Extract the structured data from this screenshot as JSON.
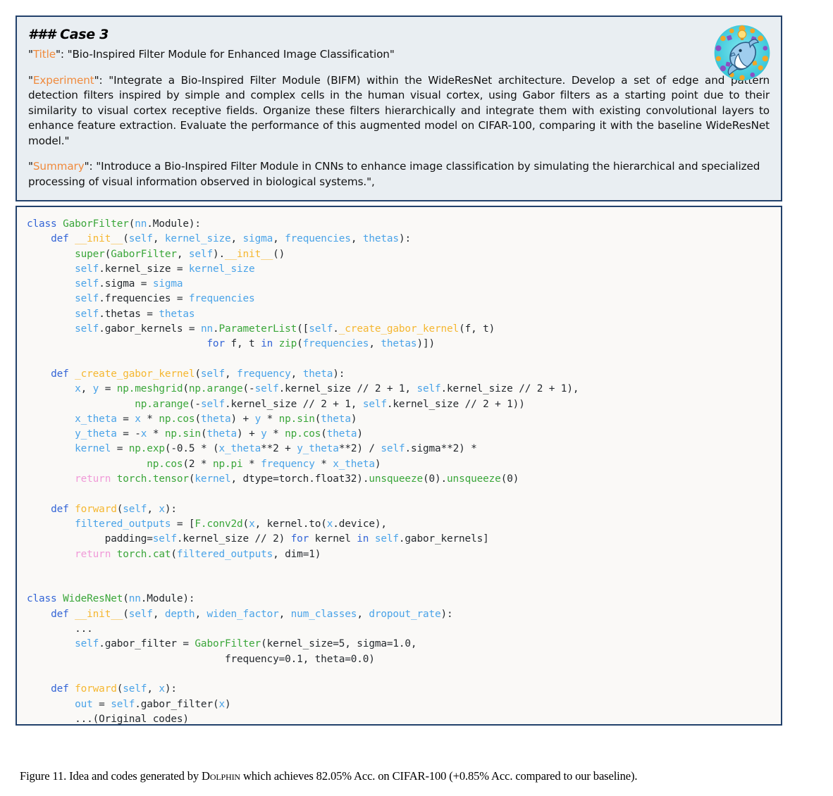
{
  "idea": {
    "case_heading_hashes": "###",
    "case_heading_text": "Case 3",
    "title_key": "Title",
    "title_value": "Bio-Inspired Filter Module for Enhanced Image Classification",
    "experiment_key": "Experiment",
    "experiment_value": "Integrate a Bio-Inspired Filter Module (BIFM) within the WideResNet architecture. Develop a set of edge and pattern detection filters inspired by simple and complex cells in the human visual cortex, using Gabor filters as a starting point due to their similarity to visual cortex receptive fields. Organize these filters hierarchically and integrate them with existing convolutional layers to enhance feature extraction. Evaluate the performance of this augmented model on CIFAR-100, comparing it with the baseline WideResNet model.",
    "summary_key": "Summary",
    "summary_value": "Introduce a Bio-Inspired Filter Module in CNNs to enhance image classification by simulating the hierarchical and specialized processing of visual information observed in biological systems.",
    "trailing_comma": ",",
    "quote": "\"",
    "colon": ": "
  },
  "logo": {
    "name": "dolphin-logo",
    "ring_color": "#f4a524",
    "disc_color": "#49d4e0",
    "body_color": "#8fc4e8",
    "accent_color": "#7b3fb5"
  },
  "code": {
    "language": "python",
    "lines": [
      [
        {
          "t": "kw",
          "s": "class"
        },
        {
          "t": "pl",
          "s": " "
        },
        {
          "t": "cls",
          "s": "GaborFilter"
        },
        {
          "t": "pl",
          "s": "("
        },
        {
          "t": "self",
          "s": "nn"
        },
        {
          "t": "pl",
          "s": ".Module):"
        }
      ],
      [
        {
          "t": "pl",
          "s": "    "
        },
        {
          "t": "kw",
          "s": "def"
        },
        {
          "t": "pl",
          "s": " "
        },
        {
          "t": "fn",
          "s": "__init__"
        },
        {
          "t": "pl",
          "s": "("
        },
        {
          "t": "self",
          "s": "self"
        },
        {
          "t": "pl",
          "s": ", "
        },
        {
          "t": "self",
          "s": "kernel_size"
        },
        {
          "t": "pl",
          "s": ", "
        },
        {
          "t": "self",
          "s": "sigma"
        },
        {
          "t": "pl",
          "s": ", "
        },
        {
          "t": "self",
          "s": "frequencies"
        },
        {
          "t": "pl",
          "s": ", "
        },
        {
          "t": "self",
          "s": "thetas"
        },
        {
          "t": "pl",
          "s": "):"
        }
      ],
      [
        {
          "t": "pl",
          "s": "        "
        },
        {
          "t": "cls",
          "s": "super"
        },
        {
          "t": "pl",
          "s": "("
        },
        {
          "t": "cls",
          "s": "GaborFilter"
        },
        {
          "t": "pl",
          "s": ", "
        },
        {
          "t": "self",
          "s": "self"
        },
        {
          "t": "pl",
          "s": ")."
        },
        {
          "t": "fn",
          "s": "__init__"
        },
        {
          "t": "pl",
          "s": "()"
        }
      ],
      [
        {
          "t": "pl",
          "s": "        "
        },
        {
          "t": "self",
          "s": "self"
        },
        {
          "t": "pl",
          "s": ".kernel_size = "
        },
        {
          "t": "self",
          "s": "kernel_size"
        }
      ],
      [
        {
          "t": "pl",
          "s": "        "
        },
        {
          "t": "self",
          "s": "self"
        },
        {
          "t": "pl",
          "s": ".sigma = "
        },
        {
          "t": "self",
          "s": "sigma"
        }
      ],
      [
        {
          "t": "pl",
          "s": "        "
        },
        {
          "t": "self",
          "s": "self"
        },
        {
          "t": "pl",
          "s": ".frequencies = "
        },
        {
          "t": "self",
          "s": "frequencies"
        }
      ],
      [
        {
          "t": "pl",
          "s": "        "
        },
        {
          "t": "self",
          "s": "self"
        },
        {
          "t": "pl",
          "s": ".thetas = "
        },
        {
          "t": "self",
          "s": "thetas"
        }
      ],
      [
        {
          "t": "pl",
          "s": "        "
        },
        {
          "t": "self",
          "s": "self"
        },
        {
          "t": "pl",
          "s": ".gabor_kernels = "
        },
        {
          "t": "self",
          "s": "nn"
        },
        {
          "t": "pl",
          "s": "."
        },
        {
          "t": "cls",
          "s": "ParameterList"
        },
        {
          "t": "pl",
          "s": "(["
        },
        {
          "t": "self",
          "s": "self"
        },
        {
          "t": "pl",
          "s": "."
        },
        {
          "t": "fn",
          "s": "_create_gabor_kernel"
        },
        {
          "t": "pl",
          "s": "(f, t)"
        }
      ],
      [
        {
          "t": "pl",
          "s": "                              "
        },
        {
          "t": "kw",
          "s": "for"
        },
        {
          "t": "pl",
          "s": " f, t "
        },
        {
          "t": "kw",
          "s": "in"
        },
        {
          "t": "pl",
          "s": " "
        },
        {
          "t": "cls",
          "s": "zip"
        },
        {
          "t": "pl",
          "s": "("
        },
        {
          "t": "self",
          "s": "frequencies"
        },
        {
          "t": "pl",
          "s": ", "
        },
        {
          "t": "self",
          "s": "thetas"
        },
        {
          "t": "pl",
          "s": ")])"
        }
      ],
      [
        {
          "t": "pl",
          "s": ""
        }
      ],
      [
        {
          "t": "pl",
          "s": "    "
        },
        {
          "t": "kw",
          "s": "def"
        },
        {
          "t": "pl",
          "s": " "
        },
        {
          "t": "fn",
          "s": "_create_gabor_kernel"
        },
        {
          "t": "pl",
          "s": "("
        },
        {
          "t": "self",
          "s": "self"
        },
        {
          "t": "pl",
          "s": ", "
        },
        {
          "t": "self",
          "s": "frequency"
        },
        {
          "t": "pl",
          "s": ", "
        },
        {
          "t": "self",
          "s": "theta"
        },
        {
          "t": "pl",
          "s": "):"
        }
      ],
      [
        {
          "t": "pl",
          "s": "        "
        },
        {
          "t": "self",
          "s": "x"
        },
        {
          "t": "pl",
          "s": ", "
        },
        {
          "t": "self",
          "s": "y"
        },
        {
          "t": "pl",
          "s": " = "
        },
        {
          "t": "cls",
          "s": "np.meshgrid"
        },
        {
          "t": "pl",
          "s": "("
        },
        {
          "t": "cls",
          "s": "np.arange"
        },
        {
          "t": "pl",
          "s": "(-"
        },
        {
          "t": "self",
          "s": "self"
        },
        {
          "t": "pl",
          "s": ".kernel_size // 2 + 1, "
        },
        {
          "t": "self",
          "s": "self"
        },
        {
          "t": "pl",
          "s": ".kernel_size // 2 + 1),"
        }
      ],
      [
        {
          "t": "pl",
          "s": "                  "
        },
        {
          "t": "cls",
          "s": "np.arange"
        },
        {
          "t": "pl",
          "s": "(-"
        },
        {
          "t": "self",
          "s": "self"
        },
        {
          "t": "pl",
          "s": ".kernel_size // 2 + 1, "
        },
        {
          "t": "self",
          "s": "self"
        },
        {
          "t": "pl",
          "s": ".kernel_size // 2 + 1))"
        }
      ],
      [
        {
          "t": "pl",
          "s": "        "
        },
        {
          "t": "self",
          "s": "x_theta"
        },
        {
          "t": "pl",
          "s": " = "
        },
        {
          "t": "self",
          "s": "x"
        },
        {
          "t": "pl",
          "s": " * "
        },
        {
          "t": "cls",
          "s": "np.cos"
        },
        {
          "t": "pl",
          "s": "("
        },
        {
          "t": "self",
          "s": "theta"
        },
        {
          "t": "pl",
          "s": ") + "
        },
        {
          "t": "self",
          "s": "y"
        },
        {
          "t": "pl",
          "s": " * "
        },
        {
          "t": "cls",
          "s": "np.sin"
        },
        {
          "t": "pl",
          "s": "("
        },
        {
          "t": "self",
          "s": "theta"
        },
        {
          "t": "pl",
          "s": ")"
        }
      ],
      [
        {
          "t": "pl",
          "s": "        "
        },
        {
          "t": "self",
          "s": "y_theta"
        },
        {
          "t": "pl",
          "s": " = -"
        },
        {
          "t": "self",
          "s": "x"
        },
        {
          "t": "pl",
          "s": " * "
        },
        {
          "t": "cls",
          "s": "np.sin"
        },
        {
          "t": "pl",
          "s": "("
        },
        {
          "t": "self",
          "s": "theta"
        },
        {
          "t": "pl",
          "s": ") + "
        },
        {
          "t": "self",
          "s": "y"
        },
        {
          "t": "pl",
          "s": " * "
        },
        {
          "t": "cls",
          "s": "np.cos"
        },
        {
          "t": "pl",
          "s": "("
        },
        {
          "t": "self",
          "s": "theta"
        },
        {
          "t": "pl",
          "s": ")"
        }
      ],
      [
        {
          "t": "pl",
          "s": "        "
        },
        {
          "t": "self",
          "s": "kernel"
        },
        {
          "t": "pl",
          "s": " = "
        },
        {
          "t": "cls",
          "s": "np.exp"
        },
        {
          "t": "pl",
          "s": "(-0.5 * ("
        },
        {
          "t": "self",
          "s": "x_theta"
        },
        {
          "t": "pl",
          "s": "**2 + "
        },
        {
          "t": "self",
          "s": "y_theta"
        },
        {
          "t": "pl",
          "s": "**2) / "
        },
        {
          "t": "self",
          "s": "self"
        },
        {
          "t": "pl",
          "s": ".sigma**2) *"
        }
      ],
      [
        {
          "t": "pl",
          "s": "                    "
        },
        {
          "t": "cls",
          "s": "np.cos"
        },
        {
          "t": "pl",
          "s": "(2 * "
        },
        {
          "t": "cls",
          "s": "np.pi"
        },
        {
          "t": "pl",
          "s": " * "
        },
        {
          "t": "self",
          "s": "frequency"
        },
        {
          "t": "pl",
          "s": " * "
        },
        {
          "t": "self",
          "s": "x_theta"
        },
        {
          "t": "pl",
          "s": ")"
        }
      ],
      [
        {
          "t": "pl",
          "s": "        "
        },
        {
          "t": "ret",
          "s": "return"
        },
        {
          "t": "pl",
          "s": " "
        },
        {
          "t": "cls",
          "s": "torch.tensor"
        },
        {
          "t": "pl",
          "s": "("
        },
        {
          "t": "self",
          "s": "kernel"
        },
        {
          "t": "pl",
          "s": ", dtype=torch.float32)."
        },
        {
          "t": "cls",
          "s": "unsqueeze"
        },
        {
          "t": "pl",
          "s": "(0)."
        },
        {
          "t": "cls",
          "s": "unsqueeze"
        },
        {
          "t": "pl",
          "s": "(0)"
        }
      ],
      [
        {
          "t": "pl",
          "s": ""
        }
      ],
      [
        {
          "t": "pl",
          "s": "    "
        },
        {
          "t": "kw",
          "s": "def"
        },
        {
          "t": "pl",
          "s": " "
        },
        {
          "t": "fn",
          "s": "forward"
        },
        {
          "t": "pl",
          "s": "("
        },
        {
          "t": "self",
          "s": "self"
        },
        {
          "t": "pl",
          "s": ", "
        },
        {
          "t": "self",
          "s": "x"
        },
        {
          "t": "pl",
          "s": "):"
        }
      ],
      [
        {
          "t": "pl",
          "s": "        "
        },
        {
          "t": "self",
          "s": "filtered_outputs"
        },
        {
          "t": "pl",
          "s": " = ["
        },
        {
          "t": "cls",
          "s": "F.conv2d"
        },
        {
          "t": "pl",
          "s": "("
        },
        {
          "t": "self",
          "s": "x"
        },
        {
          "t": "pl",
          "s": ", kernel.to("
        },
        {
          "t": "self",
          "s": "x"
        },
        {
          "t": "pl",
          "s": ".device),"
        }
      ],
      [
        {
          "t": "pl",
          "s": "             padding="
        },
        {
          "t": "self",
          "s": "self"
        },
        {
          "t": "pl",
          "s": ".kernel_size // 2) "
        },
        {
          "t": "kw",
          "s": "for"
        },
        {
          "t": "pl",
          "s": " kernel "
        },
        {
          "t": "kw",
          "s": "in"
        },
        {
          "t": "pl",
          "s": " "
        },
        {
          "t": "self",
          "s": "self"
        },
        {
          "t": "pl",
          "s": ".gabor_kernels]"
        }
      ],
      [
        {
          "t": "pl",
          "s": "        "
        },
        {
          "t": "ret",
          "s": "return"
        },
        {
          "t": "pl",
          "s": " "
        },
        {
          "t": "cls",
          "s": "torch.cat"
        },
        {
          "t": "pl",
          "s": "("
        },
        {
          "t": "self",
          "s": "filtered_outputs"
        },
        {
          "t": "pl",
          "s": ", dim=1)"
        }
      ],
      [
        {
          "t": "pl",
          "s": ""
        }
      ],
      [
        {
          "t": "pl",
          "s": ""
        }
      ],
      [
        {
          "t": "kw",
          "s": "class"
        },
        {
          "t": "pl",
          "s": " "
        },
        {
          "t": "cls",
          "s": "WideResNet"
        },
        {
          "t": "pl",
          "s": "("
        },
        {
          "t": "self",
          "s": "nn"
        },
        {
          "t": "pl",
          "s": ".Module):"
        }
      ],
      [
        {
          "t": "pl",
          "s": "    "
        },
        {
          "t": "kw",
          "s": "def"
        },
        {
          "t": "pl",
          "s": " "
        },
        {
          "t": "fn",
          "s": "__init__"
        },
        {
          "t": "pl",
          "s": "("
        },
        {
          "t": "self",
          "s": "self"
        },
        {
          "t": "pl",
          "s": ", "
        },
        {
          "t": "self",
          "s": "depth"
        },
        {
          "t": "pl",
          "s": ", "
        },
        {
          "t": "self",
          "s": "widen_factor"
        },
        {
          "t": "pl",
          "s": ", "
        },
        {
          "t": "self",
          "s": "num_classes"
        },
        {
          "t": "pl",
          "s": ", "
        },
        {
          "t": "self",
          "s": "dropout_rate"
        },
        {
          "t": "pl",
          "s": "):"
        }
      ],
      [
        {
          "t": "pl",
          "s": "        ..."
        }
      ],
      [
        {
          "t": "pl",
          "s": "        "
        },
        {
          "t": "self",
          "s": "self"
        },
        {
          "t": "pl",
          "s": ".gabor_filter = "
        },
        {
          "t": "cls",
          "s": "GaborFilter"
        },
        {
          "t": "pl",
          "s": "(kernel_size=5, sigma=1.0,"
        }
      ],
      [
        {
          "t": "pl",
          "s": "                                 frequency=0.1, theta=0.0)"
        }
      ],
      [
        {
          "t": "pl",
          "s": ""
        }
      ],
      [
        {
          "t": "pl",
          "s": "    "
        },
        {
          "t": "kw",
          "s": "def"
        },
        {
          "t": "pl",
          "s": " "
        },
        {
          "t": "fn",
          "s": "forward"
        },
        {
          "t": "pl",
          "s": "("
        },
        {
          "t": "self",
          "s": "self"
        },
        {
          "t": "pl",
          "s": ", "
        },
        {
          "t": "self",
          "s": "x"
        },
        {
          "t": "pl",
          "s": "):"
        }
      ],
      [
        {
          "t": "pl",
          "s": "        "
        },
        {
          "t": "self",
          "s": "out"
        },
        {
          "t": "pl",
          "s": " = "
        },
        {
          "t": "self",
          "s": "self"
        },
        {
          "t": "pl",
          "s": ".gabor_filter("
        },
        {
          "t": "self",
          "s": "x"
        },
        {
          "t": "pl",
          "s": ")"
        }
      ],
      [
        {
          "t": "pl",
          "s": "        ...(Original codes)"
        }
      ]
    ]
  },
  "caption": {
    "prefix": "Figure 11. Idea and codes generated by ",
    "system_name": "Dolphin",
    "suffix": " which achieves 82.05% Acc. on CIFAR-100 (+0.85% Acc. compared to our baseline)."
  },
  "colors": {
    "panel_border": "#22416b",
    "idea_bg": "#e9eef2",
    "code_bg": "#faf9f7",
    "key_orange": "#f08a3c",
    "kw_blue": "#3465d6",
    "cls_green": "#3aa63a",
    "fn_amber": "#f5b731",
    "self_blue": "#4aa3e8",
    "return_pink": "#f09ad8"
  }
}
